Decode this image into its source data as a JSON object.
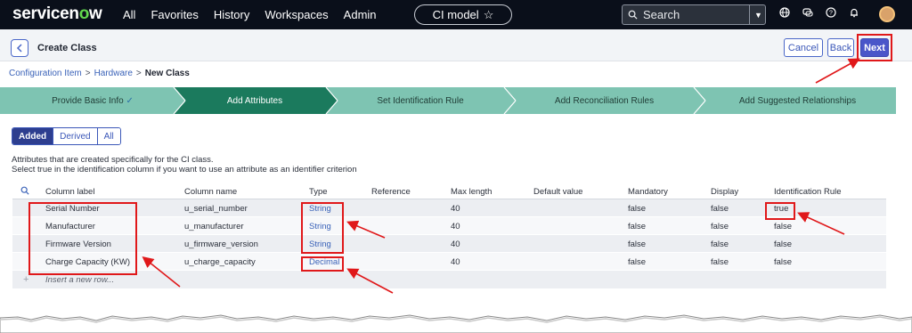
{
  "nav": {
    "logo": "servicenow",
    "menu": [
      "All",
      "Favorites",
      "History",
      "Workspaces",
      "Admin"
    ],
    "context_pill": "CI model",
    "search_placeholder": "Search"
  },
  "header": {
    "title": "Create Class",
    "cancel_label": "Cancel",
    "back_label": "Back",
    "next_label": "Next"
  },
  "breadcrumb": {
    "item1": "Configuration Item",
    "sep": ">",
    "item2": "Hardware",
    "current": "New Class"
  },
  "wizard": {
    "steps": [
      {
        "label": "Provide Basic Info",
        "done": true
      },
      {
        "label": "Add Attributes",
        "active": true
      },
      {
        "label": "Set Identification Rule"
      },
      {
        "label": "Add Reconciliation Rules"
      },
      {
        "label": "Add Suggested Relationships"
      }
    ],
    "check": "✓"
  },
  "filter": {
    "options": [
      "Added",
      "Derived",
      "All"
    ],
    "selected": "Added"
  },
  "description": {
    "line1": "Attributes that are created specifically for the CI class.",
    "line2": "Select true in the identification column if you want to use an attribute as an identifier criterion"
  },
  "table": {
    "columns": [
      "Column label",
      "Column name",
      "Type",
      "Reference",
      "Max length",
      "Default value",
      "Mandatory",
      "Display",
      "Identification Rule"
    ],
    "rows": [
      {
        "label": "Serial Number",
        "name": "u_serial_number",
        "type": "String",
        "reference": "",
        "max_length": "40",
        "default": "",
        "mandatory": "false",
        "display": "false",
        "ident": "true"
      },
      {
        "label": "Manufacturer",
        "name": "u_manufacturer",
        "type": "String",
        "reference": "",
        "max_length": "40",
        "default": "",
        "mandatory": "false",
        "display": "false",
        "ident": "false"
      },
      {
        "label": "Firmware Version",
        "name": "u_firmware_version",
        "type": "String",
        "reference": "",
        "max_length": "40",
        "default": "",
        "mandatory": "false",
        "display": "false",
        "ident": "false"
      },
      {
        "label": "Charge Capacity (KW)",
        "name": "u_charge_capacity",
        "type": "Decimal",
        "reference": "",
        "max_length": "40",
        "default": "",
        "mandatory": "false",
        "display": "false",
        "ident": "false"
      }
    ],
    "insert_row": "Insert a new row..."
  },
  "colors": {
    "nav_bg": "#0a0f1a",
    "wizard_inactive": "#7ec4b2",
    "wizard_active": "#1b7a5d",
    "accent": "#4a56c9",
    "annotation": "#e0181a"
  }
}
